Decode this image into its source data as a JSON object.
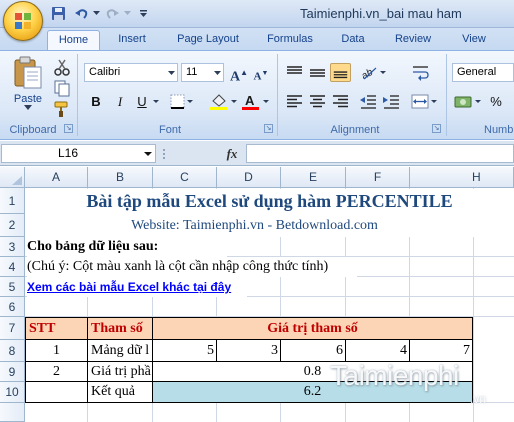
{
  "window": {
    "title": "Taimienphi.vn_bai mau ham"
  },
  "ribbon_tabs": [
    "Home",
    "Insert",
    "Page Layout",
    "Formulas",
    "Data",
    "Review",
    "View"
  ],
  "ribbon": {
    "clipboard": {
      "label": "Clipboard",
      "paste_label": "Paste"
    },
    "font": {
      "label": "Font",
      "font_name": "Calibri",
      "font_size": "11",
      "bold": "B",
      "italic": "I",
      "underline": "U",
      "grow": "A",
      "shrink": "A",
      "font_color_letter": "A",
      "fill_color": "#ffff00",
      "font_color": "#ff0000"
    },
    "alignment": {
      "label": "Alignment"
    },
    "number": {
      "label": "Numb",
      "format": "General",
      "percent": "%"
    }
  },
  "formula_bar": {
    "name_box": "L16",
    "fx": "fx",
    "formula": ""
  },
  "columns": [
    "A",
    "B",
    "C",
    "D",
    "E",
    "F",
    "H"
  ],
  "rows": [
    "1",
    "2",
    "3",
    "4",
    "5",
    "6",
    "7",
    "8",
    "9",
    "10"
  ],
  "sheet": {
    "title": "Bài tập mẫu Excel sử dụng hàm PERCENTILE",
    "website": "Website: Taimienphi.vn - Betdownload.com",
    "data_heading": "Cho bảng dữ liệu sau:",
    "note": "(Chú ý: Cột màu xanh là cột cần nhập công thức tính)",
    "link": "Xem các bài mẫu Excel khác tại đây",
    "table": {
      "headers": [
        "STT",
        "Tham số",
        "Giá trị tham số"
      ],
      "row1": {
        "stt": "1",
        "name": "Mảng dữ l",
        "values": [
          "5",
          "3",
          "6",
          "4",
          "7"
        ]
      },
      "row2": {
        "stt": "2",
        "name": "Giá trị phầ",
        "value": "0.8"
      },
      "row3": {
        "name": "Kết quả",
        "value": "6.2"
      }
    }
  },
  "watermark": {
    "text": "Taimienphi",
    "sub": ".vn"
  },
  "colors": {
    "header_fill": "#fbd5b5",
    "result_fill": "#b7dee8",
    "title_text": "#1f497d",
    "header_text": "#c00000",
    "link": "#0000ff"
  }
}
